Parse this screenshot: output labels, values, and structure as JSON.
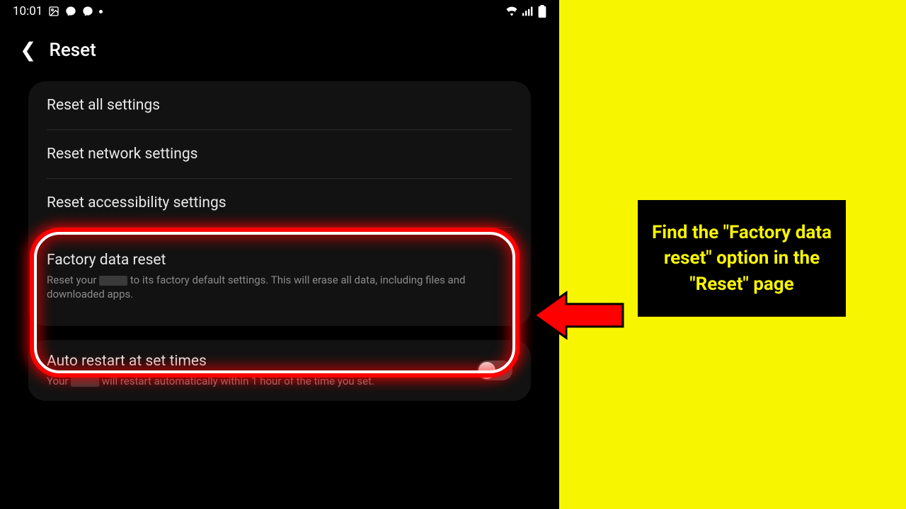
{
  "status": {
    "time": "10:01"
  },
  "header": {
    "title": "Reset"
  },
  "card1": {
    "items": [
      {
        "title": "Reset all settings"
      },
      {
        "title": "Reset network settings"
      },
      {
        "title": "Reset accessibility settings"
      },
      {
        "title": "Factory data reset",
        "sub_before": "Reset your ",
        "sub_after": " to its factory default settings. This will erase all data, including files and downloaded apps."
      }
    ]
  },
  "card2": {
    "title": "Auto restart at set times",
    "sub_before": "Your ",
    "sub_after": " will restart automatically within 1 hour of the time you set."
  },
  "callout": {
    "text": "Find the \"Factory data reset\" option in the \"Reset\" page"
  }
}
